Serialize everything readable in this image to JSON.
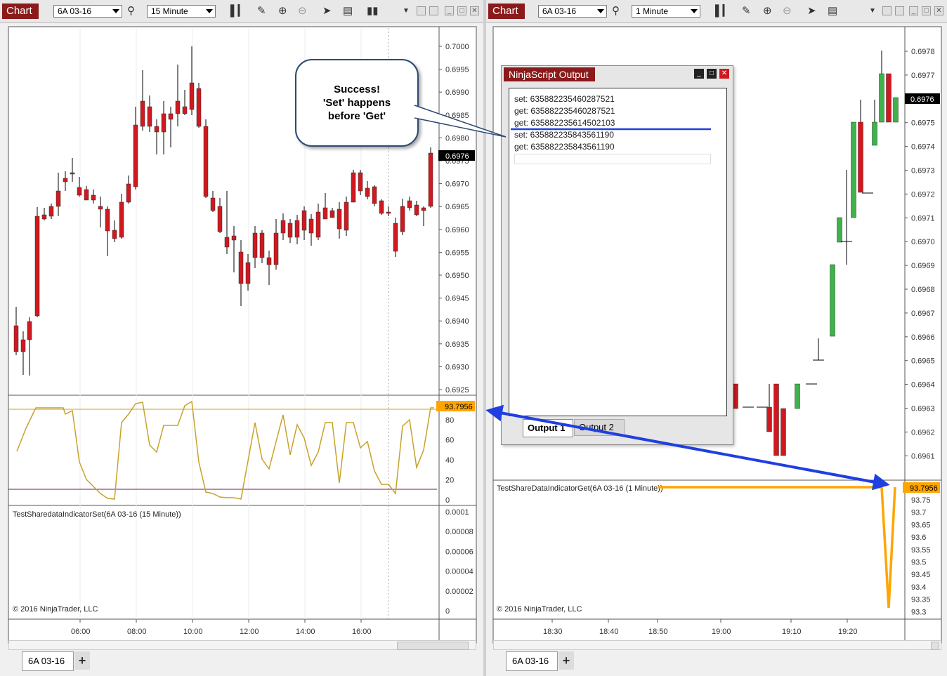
{
  "left_window": {
    "chart_tab": "Chart",
    "instrument": "6A 03-16",
    "interval": "15 Minute",
    "bottom_tab": "6A 03-16",
    "indicator_label": "TestSharedataIndicatorSet(6A 03-16 (15 Minute))",
    "copyright": "© 2016 NinjaTrader, LLC",
    "price_axis": [
      "0.7000",
      "0.6995",
      "0.6990",
      "0.6985",
      "0.6980",
      "0.6975",
      "0.6970",
      "0.6965",
      "0.6960",
      "0.6955",
      "0.6950",
      "0.6945",
      "0.6940",
      "0.6935",
      "0.6930",
      "0.6925"
    ],
    "price_tag": "0.6976",
    "osc_axis": [
      "80",
      "60",
      "40",
      "20",
      "0"
    ],
    "osc_tag": "93.7956",
    "ind_axis": [
      "0.0001",
      "0.00008",
      "0.00006",
      "0.00004",
      "0.00002",
      "0"
    ],
    "time_axis": [
      "06:00",
      "08:00",
      "10:00",
      "12:00",
      "14:00",
      "16:00"
    ]
  },
  "right_window": {
    "chart_tab": "Chart",
    "instrument": "6A 03-16",
    "interval": "1 Minute",
    "bottom_tab": "6A 03-16",
    "indicator_label": "TestShareDataIndicatorGet(6A 03-16 (1 Minute))",
    "copyright": "© 2016 NinjaTrader, LLC",
    "price_axis": [
      "0.6978",
      "0.6977",
      "0.6976",
      "0.6975",
      "0.6974",
      "0.6973",
      "0.6972",
      "0.6971",
      "0.6970",
      "0.6969",
      "0.6968",
      "0.6967",
      "0.6966",
      "0.6965",
      "0.6964",
      "0.6963",
      "0.6962",
      "0.6961"
    ],
    "price_tag": "0.6976",
    "ind_axis": [
      "93.75",
      "93.7",
      "93.65",
      "93.6",
      "93.55",
      "93.5",
      "93.45",
      "93.4",
      "93.35",
      "93.3"
    ],
    "ind_tag": "93.7956",
    "time_axis": [
      "18:30",
      "18:40",
      "18:50",
      "19:00",
      "19:10",
      "19:20"
    ]
  },
  "output_window": {
    "title": "NinjaScript Output",
    "lines": [
      "set: 635882235460287521",
      "get: 635882235460287521",
      "get: 635882235614502103",
      "set: 635882235843561190",
      "get: 635882235843561190"
    ],
    "tabs": [
      "Output 1",
      "Output 2"
    ]
  },
  "callout": {
    "lines": [
      "Success!",
      "'Set' happens",
      "before 'Get'"
    ]
  },
  "colors": {
    "up": "#3db34a",
    "down": "#d0181f",
    "accent": "#8b1a1a",
    "oscillator": "#c8a22a",
    "indicator_get": "#ffa500",
    "arrow": "#1f3fe0"
  }
}
